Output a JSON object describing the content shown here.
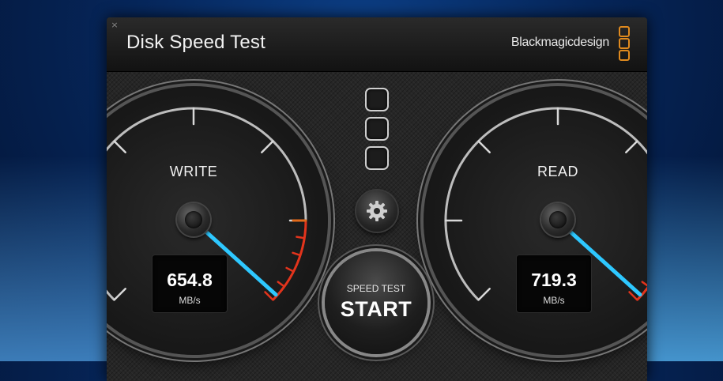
{
  "window": {
    "title": "Disk Speed Test",
    "close_icon": "×",
    "brand": "Blackmagicdesign",
    "brand_color": "#e08a1e"
  },
  "gauges": {
    "write": {
      "label": "WRITE",
      "value": "654.8",
      "unit": "MB/s"
    },
    "read": {
      "label": "READ",
      "value": "719.3",
      "unit": "MB/s"
    }
  },
  "start_button": {
    "top_label": "SPEED TEST",
    "main_label": "START"
  },
  "icons": {
    "close": "close-icon",
    "settings": "gear-icon",
    "brand_logo": "blackmagic-logo-icon",
    "target_slots": "drive-slot-icon"
  },
  "colors": {
    "needle": "#2ec8ff",
    "redline": "#e2341c",
    "redline_orange": "#e36a1a"
  }
}
